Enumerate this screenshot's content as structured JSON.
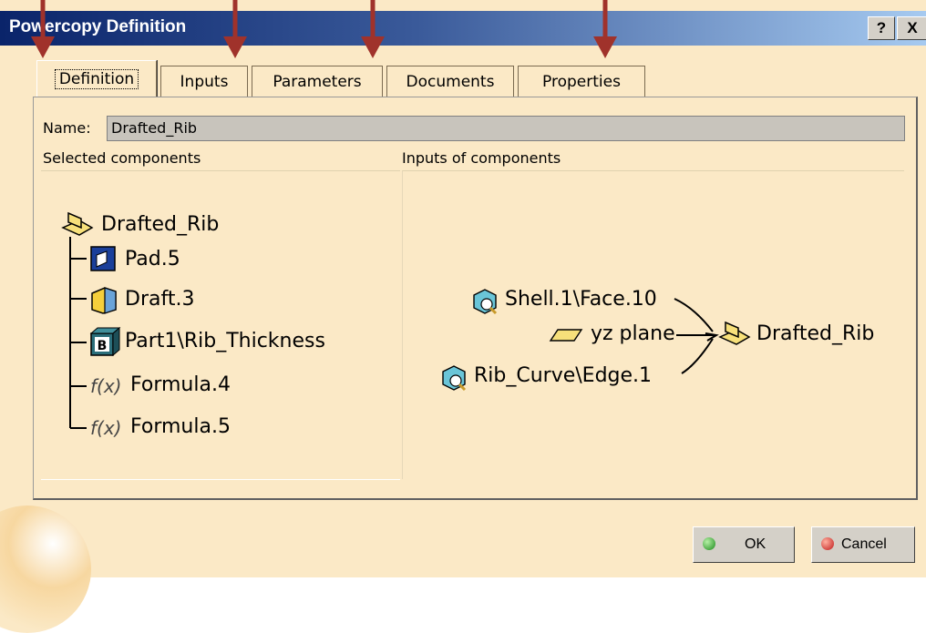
{
  "window": {
    "title": "Powercopy Definition",
    "help_btn": "?",
    "close_btn": "X"
  },
  "tabs": [
    {
      "label": "Definition",
      "active": true
    },
    {
      "label": "Inputs"
    },
    {
      "label": "Parameters"
    },
    {
      "label": "Documents"
    },
    {
      "label": "Properties"
    }
  ],
  "name_field": {
    "label": "Name:",
    "value": "Drafted_Rib"
  },
  "headers": {
    "left": "Selected components",
    "right": "Inputs of components"
  },
  "tree": {
    "root": "Drafted_Rib",
    "children": [
      "Pad.5",
      "Draft.3",
      "Part1\\Rib_Thickness",
      "Formula.4",
      "Formula.5"
    ]
  },
  "inputs": {
    "items": [
      "Shell.1\\Face.10",
      "yz plane",
      "Rib_Curve\\Edge.1"
    ],
    "target": "Drafted_Rib"
  },
  "buttons": {
    "ok": "OK",
    "cancel": "Cancel"
  },
  "colors": {
    "arrow": "#a0322b",
    "background": "#fbe9c6",
    "titlebar": "#0a246a"
  }
}
